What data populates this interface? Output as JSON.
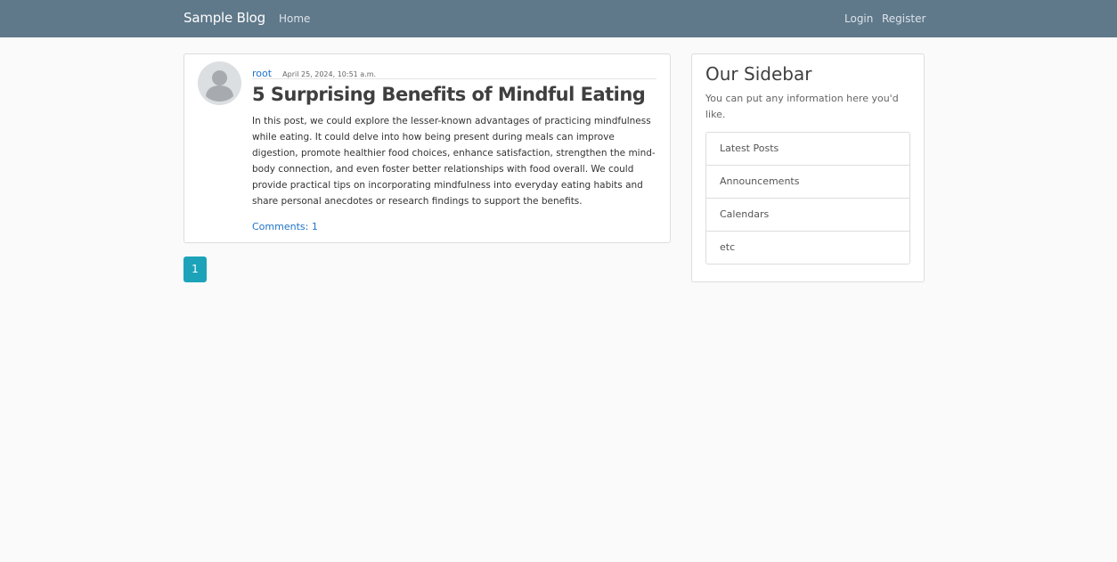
{
  "nav": {
    "brand": "Sample Blog",
    "home": "Home",
    "login": "Login",
    "register": "Register"
  },
  "post": {
    "author": "root",
    "date": "April 25, 2024, 10:51 a.m.",
    "title": "5 Surprising Benefits of Mindful Eating",
    "content": "In this post, we could explore the lesser-known advantages of practicing mindfulness while eating. It could delve into how being present during meals can improve digestion, promote healthier food choices, enhance satisfaction, strengthen the mind-body connection, and even foster better relationships with food overall. We could provide practical tips on incorporating mindfulness into everyday eating habits and share personal anecdotes or research findings to support the benefits.",
    "comments": "Comments: 1"
  },
  "pagination": {
    "current_page": "1"
  },
  "sidebar": {
    "title": "Our Sidebar",
    "text": "You can put any information here you'd like.",
    "items": [
      {
        "label": "Latest Posts"
      },
      {
        "label": "Announcements"
      },
      {
        "label": "Calendars"
      },
      {
        "label": "etc"
      }
    ]
  },
  "colors": {
    "navbar": "#5f788a",
    "link": "#1f73c9",
    "pagination_active": "#1ca3b9",
    "page_background": "#fafafa"
  },
  "icons": {
    "avatar": "default-user-avatar-icon"
  }
}
